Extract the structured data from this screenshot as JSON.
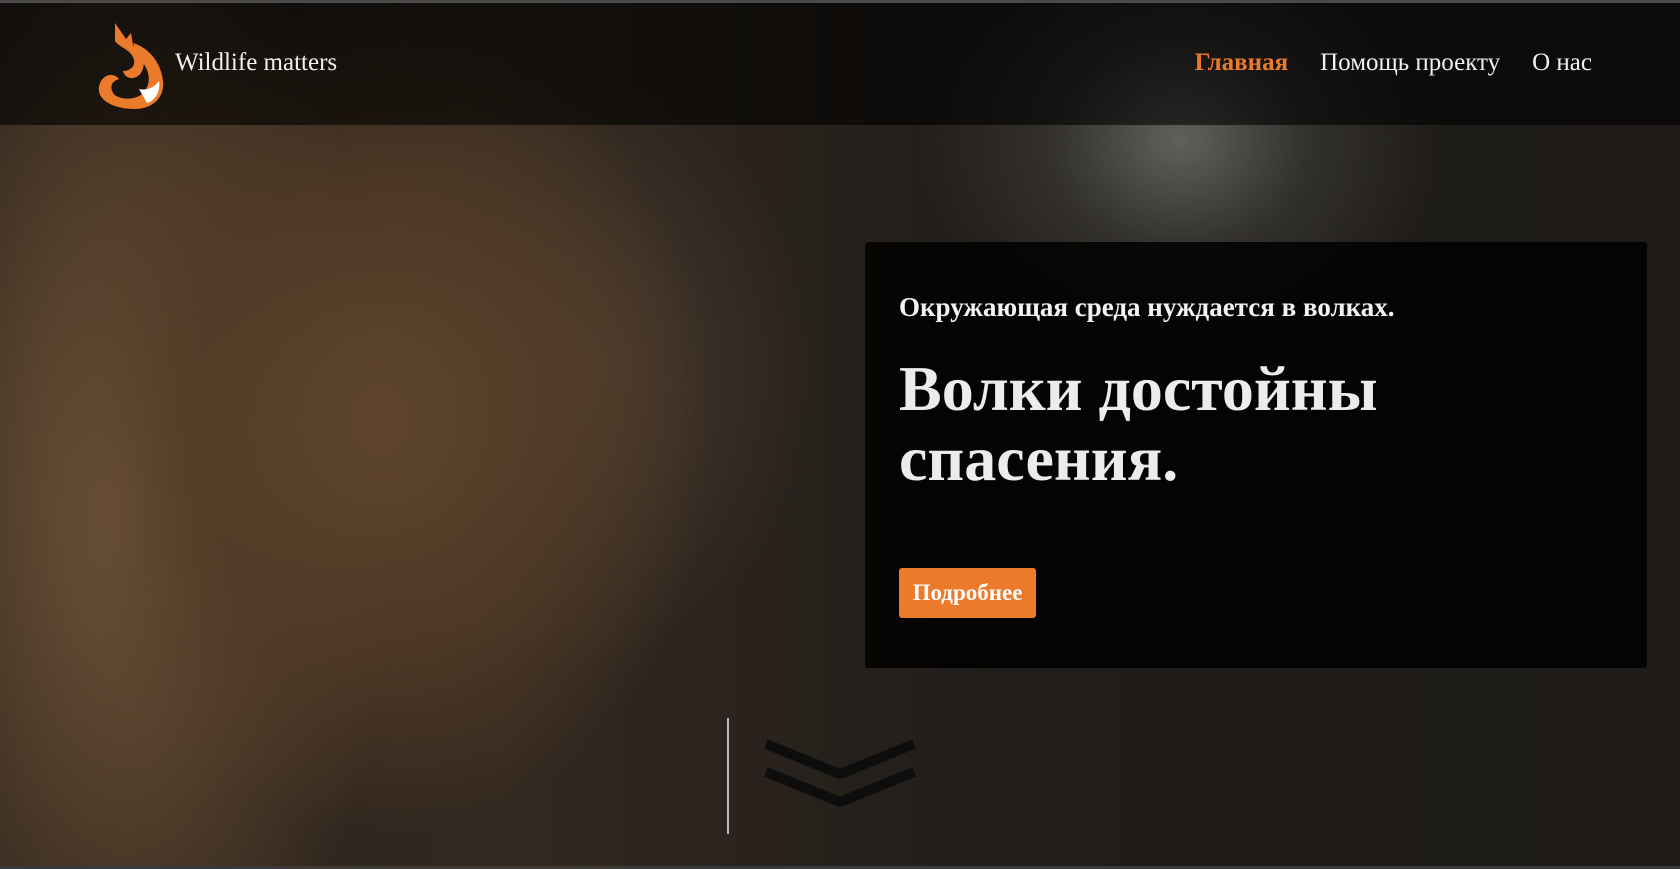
{
  "header": {
    "brand": "Wildlife matters",
    "logo_icon": "fox-logo-icon",
    "nav": [
      {
        "label": "Главная",
        "active": true
      },
      {
        "label": "Помощь проекту",
        "active": false
      },
      {
        "label": "О нас",
        "active": false
      }
    ]
  },
  "hero": {
    "background_icon": "wolf-photo",
    "kicker": "Окружающая среда нуждается в волках.",
    "headline": "Волки достойны спасения.",
    "cta_label": "Подробнее",
    "scroll_icon": "double-chevron-down-icon"
  },
  "colors": {
    "accent": "#ec7a2b",
    "text": "#f1f1f1",
    "header_bg": "#000000",
    "panel_bg": "#000000"
  }
}
